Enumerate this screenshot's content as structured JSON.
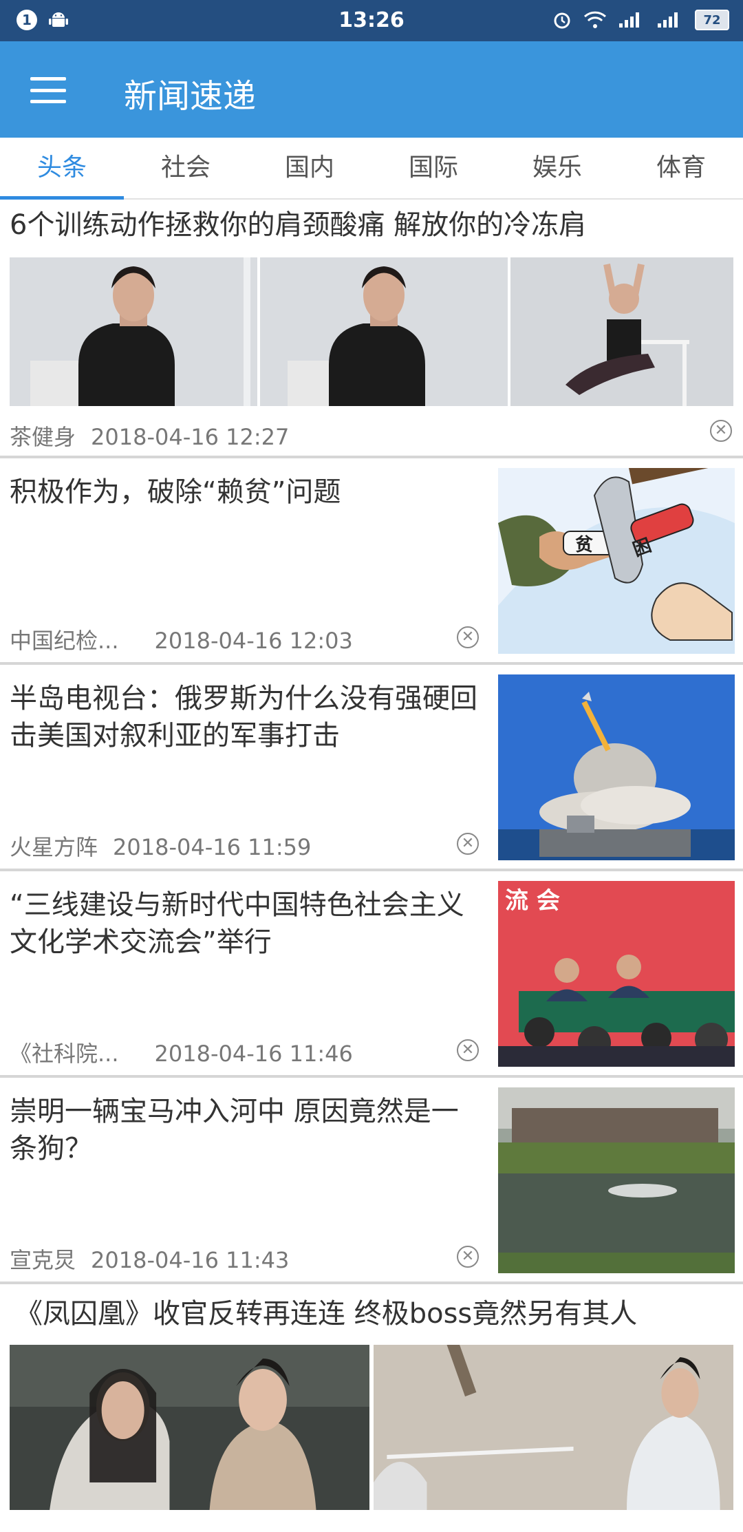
{
  "status_bar": {
    "notification_count": "1",
    "time": "13:26",
    "battery": "72"
  },
  "app_bar": {
    "title": "新闻速递"
  },
  "tabs": [
    {
      "label": "头条",
      "active": true
    },
    {
      "label": "社会",
      "active": false
    },
    {
      "label": "国内",
      "active": false
    },
    {
      "label": "国际",
      "active": false
    },
    {
      "label": "娱乐",
      "active": false
    },
    {
      "label": "体育",
      "active": false
    }
  ],
  "feed": [
    {
      "title": "6个训练动作拯救你的肩颈酸痛 解放你的冷冻肩",
      "source": "茶健身",
      "date": "2018-04-16 12:27"
    },
    {
      "title": "积极作为，破除“赖贫”问题",
      "source": "中国纪检...",
      "date": "2018-04-16 12:03",
      "image_text_1": "贫",
      "image_text_2": "困"
    },
    {
      "title": "半岛电视台：俄罗斯为什么没有强硬回击美国对叙利亚的军事打击",
      "source": "火星方阵",
      "date": "2018-04-16 11:59"
    },
    {
      "title": "“三线建设与新时代中国特色社会主义文化学术交流会”举行",
      "source": "《社科院...",
      "date": "2018-04-16 11:46",
      "image_text": "流  会"
    },
    {
      "title": "崇明一辆宝马冲入河中 原因竟然是一条狗？",
      "source": "宣克炅",
      "date": "2018-04-16 11:43"
    },
    {
      "title": "《凤囚凰》收官反转再连连 终极boss竟然另有其人"
    }
  ],
  "colors": {
    "status_bar": "#244e80",
    "app_bar": "#3a95dc",
    "tab_active": "#2f8be0"
  }
}
